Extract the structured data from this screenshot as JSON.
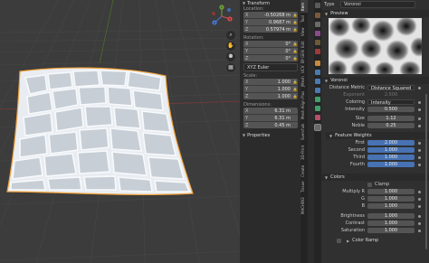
{
  "viewport": {
    "gizmo": {
      "x": "X",
      "y": "Y",
      "z": "Z"
    },
    "nav_buttons": [
      "⌕",
      "✋",
      "⚉",
      "▦"
    ]
  },
  "npanel": {
    "transform_title": "Transform",
    "location_label": "Location:",
    "location": [
      {
        "axis": "X",
        "value": "-0.50268 m"
      },
      {
        "axis": "Y",
        "value": "0.9687 m"
      },
      {
        "axis": "Z",
        "value": "0.57974 m"
      }
    ],
    "rotation_label": "Rotation:",
    "rotation": [
      {
        "axis": "X",
        "value": "0°"
      },
      {
        "axis": "Y",
        "value": "0°"
      },
      {
        "axis": "Z",
        "value": "0°"
      }
    ],
    "rotation_mode": "XYZ Euler",
    "scale_label": "Scale:",
    "scale": [
      {
        "axis": "X",
        "value": "1.000"
      },
      {
        "axis": "Y",
        "value": "1.000"
      },
      {
        "axis": "Z",
        "value": "1.000"
      }
    ],
    "dimensions_label": "Dimensions:",
    "dimensions": [
      {
        "axis": "X",
        "value": "6.31 m"
      },
      {
        "axis": "Y",
        "value": "6.31 m"
      },
      {
        "axis": "Z",
        "value": "0.45 m"
      }
    ],
    "properties_title": "Properties"
  },
  "side_tabs": [
    "Item",
    "Tool",
    "View",
    "Edit",
    "BY-GEN",
    "UCV",
    "JMesh",
    "Mesh Align Plus",
    "Sverchok",
    "3D-Print",
    "Create",
    "Tissue",
    "MACHIN3"
  ],
  "props": {
    "type_label": "Type",
    "type_value": "Voronoi",
    "preview_title": "Preview",
    "voronoi_title": "Voronoi",
    "distance_metric_label": "Distance Metric",
    "distance_metric_value": "Distance Squared",
    "exponent_label": "Exponent",
    "exponent_value": "2.500",
    "coloring_label": "Coloring",
    "coloring_value": "Intensity",
    "intensity_label": "Intensity",
    "intensity_value": "0.500",
    "size_label": "Size",
    "size_value": "1.12",
    "noble_label": "Noble",
    "noble_value": "0.25",
    "feature_weights_title": "Feature Weights",
    "weights": [
      {
        "label": "First",
        "value": "2.000"
      },
      {
        "label": "Second",
        "value": "1.000"
      },
      {
        "label": "Third",
        "value": "1.000"
      },
      {
        "label": "Fourth",
        "value": "1.000"
      }
    ],
    "colors_title": "Colors",
    "clamp_label": "Clamp",
    "multiply": [
      {
        "label": "Multiply R",
        "value": "1.000"
      },
      {
        "label": "G",
        "value": "1.000"
      },
      {
        "label": "B",
        "value": "1.000"
      }
    ],
    "brightness_label": "Brightness",
    "brightness_value": "1.000",
    "contrast_label": "Contrast",
    "contrast_value": "1.000",
    "saturation_label": "Saturation",
    "saturation_value": "1.000",
    "color_ramp_label": "Color Ramp"
  }
}
